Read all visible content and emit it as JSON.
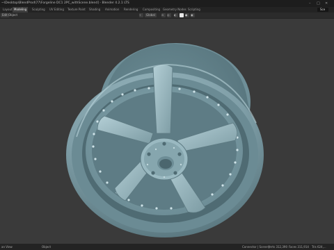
{
  "window": {
    "title": "~\\Desktop\\BlendProd\\77\\Forgeline DC1 2PC_withScene.blend] - Blender 4.2.1 LTS",
    "minimize_icon": "minimize-icon",
    "maximize_icon": "maximize-icon",
    "close_icon": "close-icon"
  },
  "workspaces": {
    "tabs": [
      "Layout",
      "Modeling",
      "Sculpting",
      "UV Editing",
      "Texture Paint",
      "Shading",
      "Animation",
      "Rendering",
      "Compositing",
      "Geometry Nodes",
      "Scripting"
    ],
    "active": "Modeling",
    "scene_label": "Sce"
  },
  "toolbar": {
    "mode": "Edit",
    "object_menu": "Object",
    "transform_orientation": "Global"
  },
  "status": {
    "left": "an View",
    "middle": "Object",
    "right_prefix": "Connector | Scene |",
    "verts": "Verts 312,390",
    "faces": "Faces 311,914",
    "tris": "Tris 624,..."
  },
  "colors": {
    "viewport_bg": "#3a3a3a",
    "wheel_base": "#7c9ca6",
    "wheel_light": "#a9c6ce",
    "wheel_dark": "#5a7880",
    "active_tab": "#3e3e3e"
  }
}
